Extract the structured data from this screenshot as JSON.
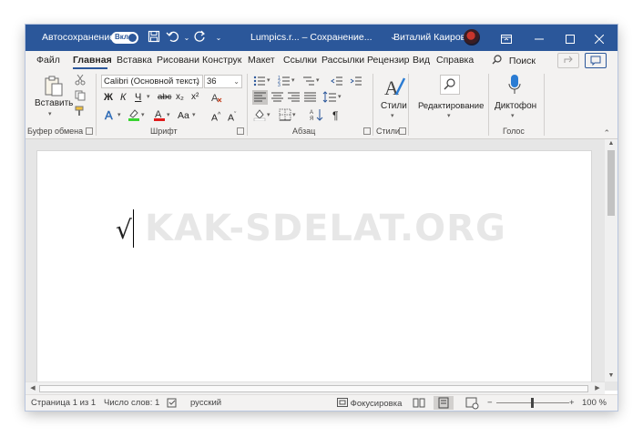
{
  "titlebar": {
    "autosave_label": "Автосохранение",
    "toggle_label": "Вкл.",
    "doc_title": "Lumpics.r... – Сохранение...",
    "user_name": "Виталий Каиров",
    "save_icon": "save-icon",
    "undo_icon": "undo-icon",
    "redo_icon": "redo-icon",
    "accent_color": "#2b579a"
  },
  "tabs": [
    "Файл",
    "Главная",
    "Вставка",
    "Рисовани",
    "Конструк",
    "Макет",
    "Ссылки",
    "Рассылки",
    "Рецензир",
    "Вид",
    "Справка"
  ],
  "search_label": "Поиск",
  "ribbon": {
    "clipboard": {
      "paste_label": "Вставить",
      "group_label": "Буфер обмена"
    },
    "font": {
      "font_name": "Calibri (Основной текст)",
      "font_size": "36",
      "group_label": "Шрифт",
      "bold": "Ж",
      "italic": "К",
      "underline": "Ч",
      "strike": "abc",
      "subscript": "x₂",
      "superscript": "x²",
      "case": "Aa"
    },
    "paragraph": {
      "group_label": "Абзац"
    },
    "styles": {
      "label": "Стили",
      "group_label": "Стили"
    },
    "editing": {
      "label": "Редактирование"
    },
    "voice": {
      "label": "Диктофон",
      "group_label": "Голос"
    }
  },
  "document": {
    "content": "√",
    "watermark": "KAK-SDELAT.ORG"
  },
  "status": {
    "page": "Страница 1 из 1",
    "words": "Число слов: 1",
    "language": "русский",
    "focus": "Фокусировка",
    "zoom": "100 %",
    "zoom_minus": "−",
    "zoom_plus": "+"
  }
}
